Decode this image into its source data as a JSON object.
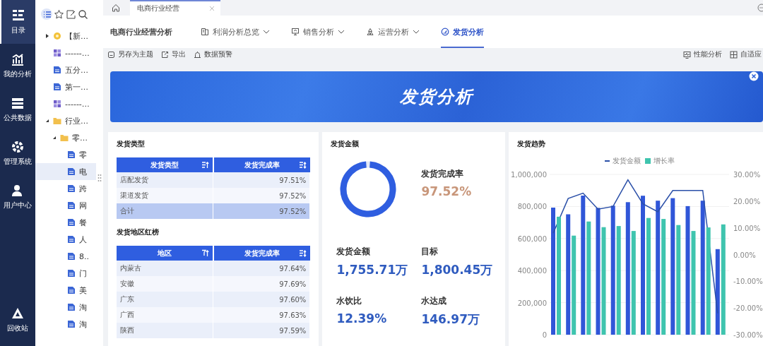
{
  "nav": {
    "items": [
      {
        "label": "目录",
        "selected": true
      },
      {
        "label": "我的分析",
        "selected": false
      },
      {
        "label": "公共数据",
        "selected": false
      },
      {
        "label": "管理系统",
        "selected": false
      },
      {
        "label": "用户中心",
        "selected": false
      }
    ],
    "bottom": {
      "label": "回收站"
    }
  },
  "tree_toolbar": [
    {
      "selected": true
    },
    {
      "selected": false
    },
    {
      "selected": false
    },
    {
      "selected": false
    }
  ],
  "tree": [
    {
      "label": "【新…",
      "kind": "theme",
      "expanded": false,
      "selected": false
    },
    {
      "label": "------…",
      "kind": "grid",
      "selected": false
    },
    {
      "label": "五分…",
      "kind": "doc",
      "selected": false
    },
    {
      "label": "第一…",
      "kind": "doc",
      "selected": false
    },
    {
      "label": "------…",
      "kind": "grid",
      "selected": false
    },
    {
      "label": "行业…",
      "kind": "folder",
      "expanded": true,
      "selected": false,
      "children": [
        {
          "label": "零…",
          "kind": "folder",
          "expanded": true,
          "selected": false,
          "children": [
            {
              "label": "零",
              "kind": "doc",
              "selected": false
            },
            {
              "label": "电",
              "kind": "doc",
              "selected": true
            },
            {
              "label": "跨",
              "kind": "doc",
              "selected": false
            },
            {
              "label": "网",
              "kind": "doc",
              "selected": false
            },
            {
              "label": "餐",
              "kind": "doc",
              "selected": false
            },
            {
              "label": "人",
              "kind": "doc",
              "selected": false
            },
            {
              "label": "8..",
              "kind": "doc",
              "selected": false
            },
            {
              "label": "门",
              "kind": "doc",
              "selected": false
            },
            {
              "label": "美",
              "kind": "doc",
              "selected": false
            },
            {
              "label": "淘",
              "kind": "doc",
              "selected": false
            },
            {
              "label": "淘",
              "kind": "doc",
              "selected": false
            }
          ]
        }
      ]
    }
  ],
  "tabs": [
    {
      "label": "电商行业经营",
      "selected": true
    }
  ],
  "header": {
    "title": "电商行业经营分析",
    "menu": [
      {
        "label": "利润分析总览",
        "dropdown": true,
        "selected": false
      },
      {
        "label": "销售分析",
        "dropdown": true,
        "selected": false
      },
      {
        "label": "运营分析",
        "dropdown": true,
        "selected": false
      },
      {
        "label": "发货分析",
        "dropdown": false,
        "selected": true
      }
    ]
  },
  "toolbar": {
    "left": [
      {
        "label": "另存为主题"
      },
      {
        "label": "导出"
      },
      {
        "label": "数据预警"
      }
    ],
    "right": [
      {
        "label": "性能分析"
      },
      {
        "label": "自适应"
      }
    ]
  },
  "banner": {
    "title": "发货分析"
  },
  "type_table": {
    "title": "发货类型",
    "columns": [
      {
        "label": "发货类型"
      },
      {
        "label": "发货完成率"
      }
    ],
    "rows": [
      {
        "cells": [
          "店配发货",
          "97.51%"
        ],
        "total": false
      },
      {
        "cells": [
          "渠道发货",
          "97.52%"
        ],
        "total": false
      },
      {
        "cells": [
          "合计",
          "97.52%"
        ],
        "total": true
      }
    ]
  },
  "region_table": {
    "title": "发货地区红榜",
    "columns": [
      {
        "label": "地区"
      },
      {
        "label": "发货完成率"
      }
    ],
    "rows": [
      {
        "cells": [
          "内蒙古",
          "97.64%"
        ],
        "total": false
      },
      {
        "cells": [
          "安徽",
          "97.69%"
        ],
        "total": false
      },
      {
        "cells": [
          "广东",
          "97.60%"
        ],
        "total": false
      },
      {
        "cells": [
          "广西",
          "97.63%"
        ],
        "total": false
      },
      {
        "cells": [
          "陕西",
          "97.59%"
        ],
        "total": false
      }
    ]
  },
  "amount_panel": {
    "title": "发货金额",
    "donut": {
      "level": 0.9752
    },
    "metrics": [
      {
        "label": "发货完成率",
        "value": "97.52%",
        "color": "#c8967a"
      },
      {
        "label": "发货金额",
        "value": "1,755.71万",
        "color": "#2f5bbf"
      },
      {
        "label": "目标",
        "value": "1,800.45万",
        "color": "#2f5bbf"
      },
      {
        "label": "水饮比",
        "value": "12.39%",
        "color": "#2f5bbf"
      },
      {
        "label": "水达成",
        "value": "146.97万",
        "color": "#2f5bbf"
      }
    ]
  },
  "trend_panel": {
    "title": "发货趋势",
    "chart_data": {
      "type": "bar",
      "stacked": false,
      "grid": true,
      "series": [
        {
          "color": "#3056d8",
          "values": [
            793000,
            751000,
            868000,
            791000,
            805000,
            827000,
            867000,
            836000,
            852000,
            802000,
            836000,
            534000
          ]
        },
        {
          "name": "发货金额",
          "type": "line",
          "axis": "y2",
          "color": "#2a4fa8",
          "values": [
            8,
            21,
            23,
            17,
            18,
            28,
            19,
            16,
            24,
            24,
            24,
            -22
          ]
        },
        {
          "name": "增长率",
          "color": "#3fc4ae",
          "values": [
            736000,
            618000,
            706000,
            671000,
            678000,
            647000,
            728000,
            722000,
            684000,
            647000,
            669000,
            688000
          ]
        }
      ],
      "ylim": [
        0,
        1000000
      ],
      "yticks": [
        {
          "value": 0,
          "label": "0"
        },
        {
          "value": 200000,
          "label": "200,000"
        },
        {
          "value": 400000,
          "label": "400,000"
        },
        {
          "value": 600000,
          "label": "600,000"
        },
        {
          "value": 800000,
          "label": "800,000"
        },
        {
          "value": 1000000,
          "label": "1,000,000"
        }
      ],
      "y2lim": [
        -30,
        30
      ],
      "y2ticks": [
        {
          "value": 30,
          "label": "30.00%"
        },
        {
          "value": 20,
          "label": "20.00%"
        },
        {
          "value": 10,
          "label": "10.00%"
        },
        {
          "value": 0,
          "label": "0.00%"
        },
        {
          "value": -10,
          "label": "-10.00%"
        },
        {
          "value": -20,
          "label": "-20.00%"
        },
        {
          "value": -30,
          "label": "-30.00%"
        }
      ]
    }
  }
}
